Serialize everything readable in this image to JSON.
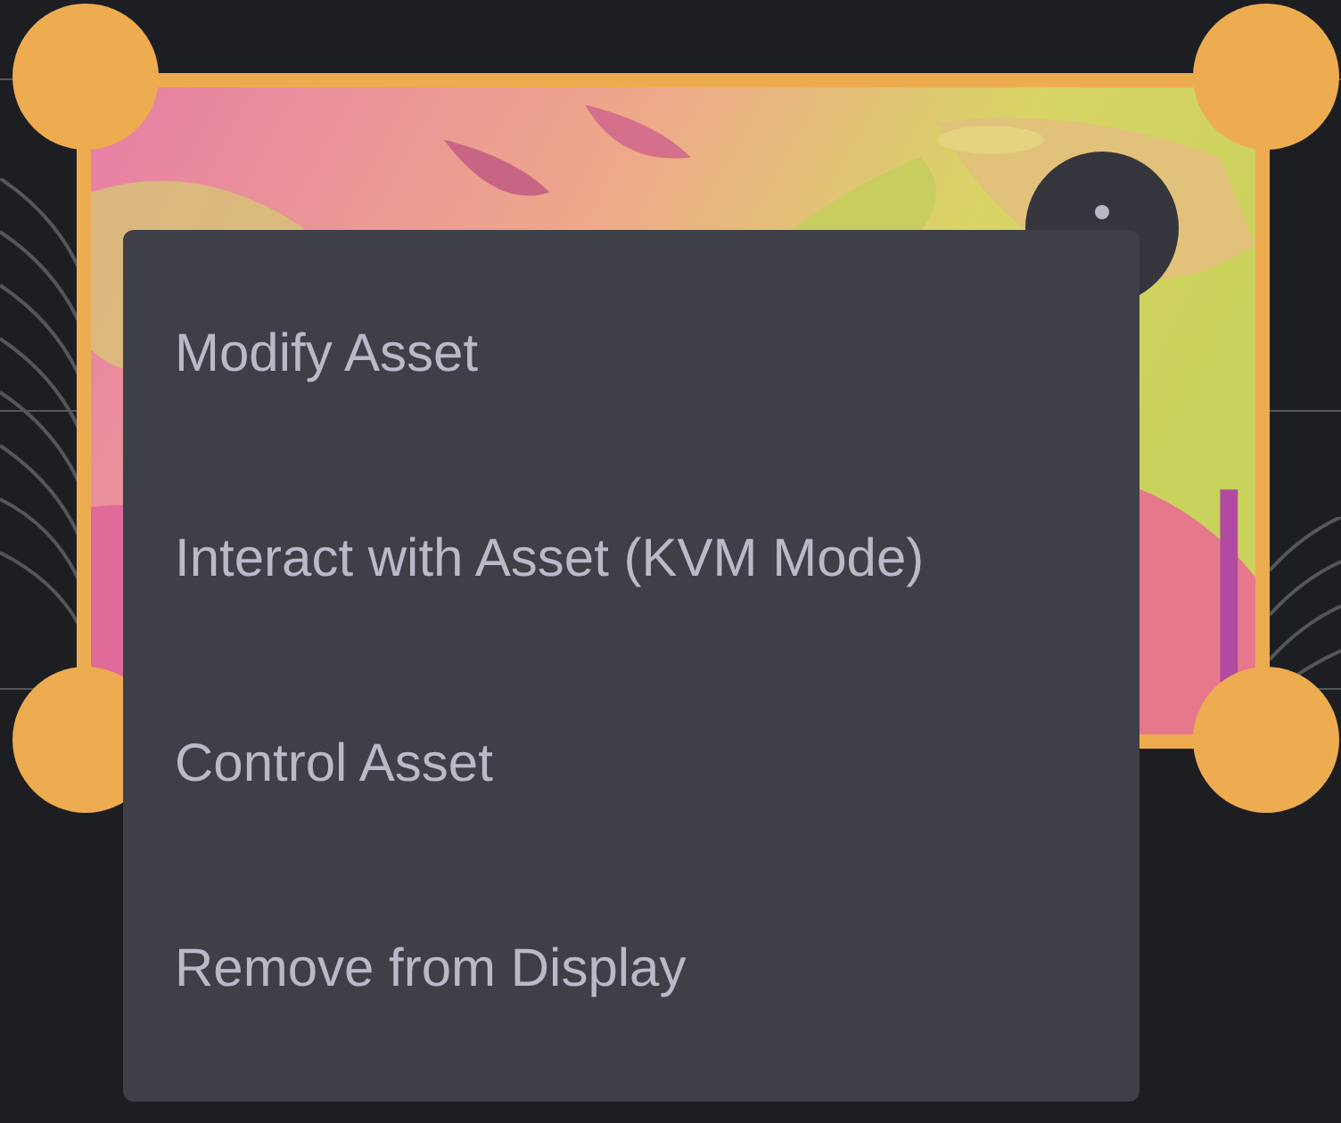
{
  "context_menu": {
    "items": [
      {
        "label": "Modify Asset"
      },
      {
        "label": "Interact with Asset (KVM Mode)"
      },
      {
        "label": "Control Asset"
      },
      {
        "label": "Remove from Display"
      }
    ]
  }
}
